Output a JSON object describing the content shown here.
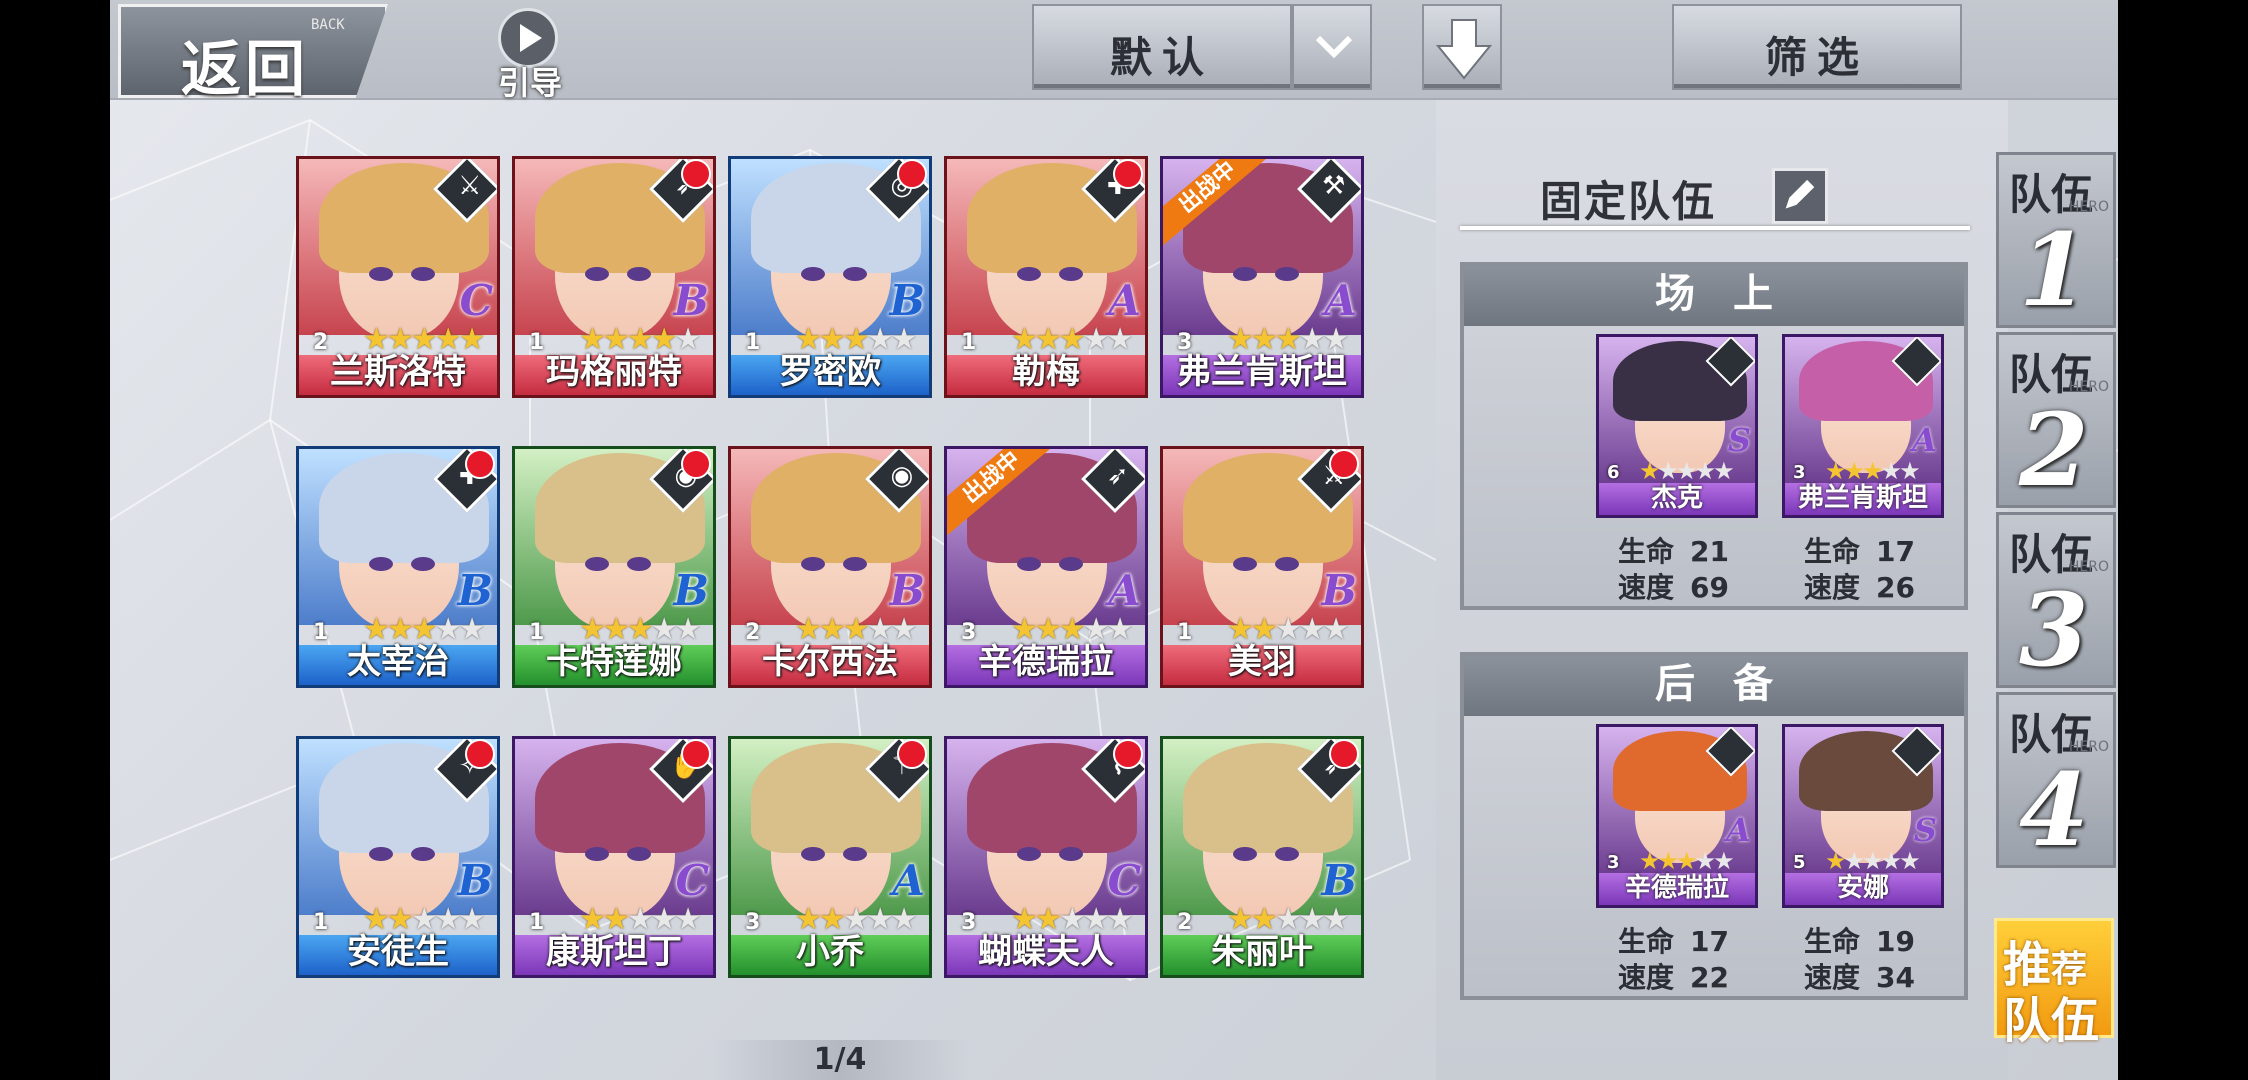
{
  "topbar": {
    "back_label": "返回",
    "back_sub": "BACK",
    "guide_label": "引导",
    "sort_label": "默认",
    "filter_label": "筛选"
  },
  "heroes": [
    {
      "name": "兰斯洛特",
      "level": "2",
      "stars": 5,
      "rank": "C",
      "color": "red",
      "cls": "⚔",
      "dot": false,
      "deployed": false
    },
    {
      "name": "玛格丽特",
      "level": "1",
      "stars": 4,
      "rank": "B",
      "color": "red",
      "cls": "➶",
      "dot": true,
      "deployed": false
    },
    {
      "name": "罗密欧",
      "level": "1",
      "stars": 3,
      "rank": "B",
      "color": "blue",
      "cls": "◎",
      "dot": true,
      "deployed": false
    },
    {
      "name": "勒梅",
      "level": "1",
      "stars": 3,
      "rank": "A",
      "color": "red",
      "cls": "✚",
      "dot": true,
      "deployed": false
    },
    {
      "name": "弗兰肯斯坦",
      "level": "3",
      "stars": 3,
      "rank": "A",
      "color": "purple",
      "cls": "⚒",
      "dot": false,
      "deployed": true
    },
    {
      "name": "太宰治",
      "level": "1",
      "stars": 3,
      "rank": "B",
      "color": "blue",
      "cls": "✚",
      "dot": true,
      "deployed": false
    },
    {
      "name": "卡特莲娜",
      "level": "1",
      "stars": 3,
      "rank": "B",
      "color": "green",
      "cls": "◉",
      "dot": true,
      "deployed": false
    },
    {
      "name": "卡尔西法",
      "level": "2",
      "stars": 3,
      "rank": "B",
      "color": "red",
      "cls": "◉",
      "dot": false,
      "deployed": false
    },
    {
      "name": "辛德瑞拉",
      "level": "3",
      "stars": 3,
      "rank": "A",
      "color": "purple",
      "cls": "➶",
      "dot": false,
      "deployed": true
    },
    {
      "name": "美羽",
      "level": "1",
      "stars": 2,
      "rank": "B",
      "color": "red",
      "cls": "⚔",
      "dot": true,
      "deployed": false
    },
    {
      "name": "安徒生",
      "level": "1",
      "stars": 2,
      "rank": "B",
      "color": "blue",
      "cls": "✧",
      "dot": true,
      "deployed": false
    },
    {
      "name": "康斯坦丁",
      "level": "1",
      "stars": 2,
      "rank": "C",
      "color": "purple",
      "cls": "✋",
      "dot": true,
      "deployed": false
    },
    {
      "name": "小乔",
      "level": "3",
      "stars": 2,
      "rank": "A",
      "color": "green",
      "cls": "⚚",
      "dot": true,
      "deployed": false
    },
    {
      "name": "蝴蝶夫人",
      "level": "3",
      "stars": 2,
      "rank": "C",
      "color": "purple",
      "cls": "⌇",
      "dot": true,
      "deployed": false
    },
    {
      "name": "朱丽叶",
      "level": "2",
      "stars": 2,
      "rank": "B",
      "color": "green",
      "cls": "➶",
      "dot": true,
      "deployed": false
    }
  ],
  "deployed_tag": "出战中",
  "team": {
    "title": "固定队伍",
    "field_label": "场上",
    "reserve_label": "后备",
    "stat_hp": "生命",
    "stat_speed": "速度",
    "field": [
      {
        "name": "杰克",
        "level": "6",
        "stars": 1,
        "rank": "S",
        "hp": "21",
        "speed": "69",
        "hair": "#3a3046"
      },
      {
        "name": "弗兰肯斯坦",
        "level": "3",
        "stars": 3,
        "rank": "A",
        "hp": "17",
        "speed": "26",
        "hair": "#c45fa8"
      }
    ],
    "reserve": [
      {
        "name": "辛德瑞拉",
        "level": "3",
        "stars": 3,
        "rank": "A",
        "hp": "17",
        "speed": "22",
        "hair": "#e06a2d"
      },
      {
        "name": "安娜",
        "level": "5",
        "stars": 1,
        "rank": "S",
        "hp": "19",
        "speed": "34",
        "hair": "#6b4a3e"
      }
    ]
  },
  "tabs": [
    {
      "label": "队伍",
      "num": "1",
      "sub": "HERO"
    },
    {
      "label": "队伍",
      "num": "2",
      "sub": "HERO"
    },
    {
      "label": "队伍",
      "num": "3",
      "sub": "HERO"
    },
    {
      "label": "队伍",
      "num": "4",
      "sub": "HERO"
    }
  ],
  "recommend": {
    "l1a": "推",
    "l1b": "荐",
    "l2": "队伍"
  },
  "pager": "1/4",
  "colors": {
    "red": "#c52c40",
    "blue": "#1d62c9",
    "purple": "#7b37b8",
    "green": "#24902d",
    "accent": "#f29a10",
    "alert": "#e6192b"
  }
}
